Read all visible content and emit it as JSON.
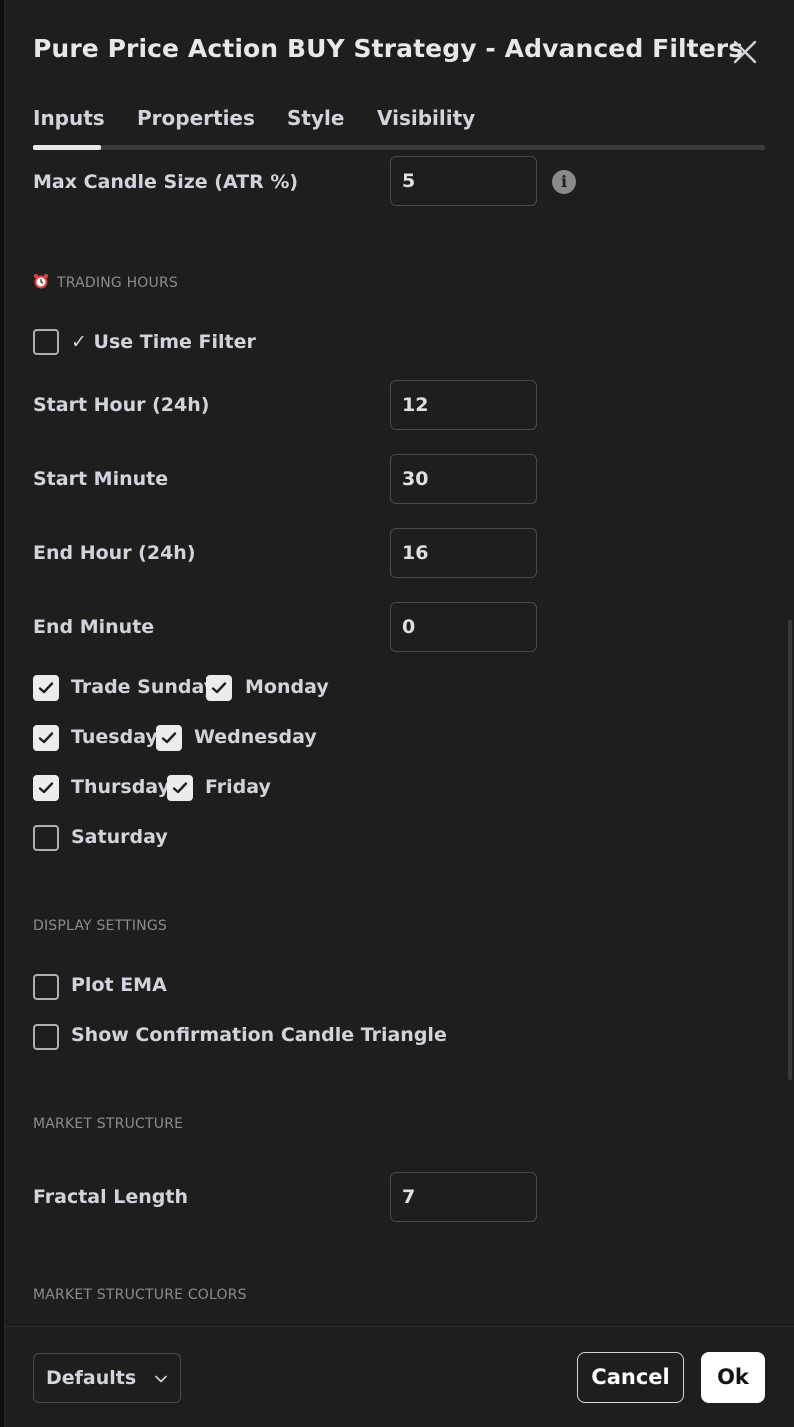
{
  "dialog": {
    "title": "Pure Price Action BUY Strategy - Advanced Filters",
    "tabs": [
      {
        "label": "Inputs",
        "active": true
      },
      {
        "label": "Properties",
        "active": false
      },
      {
        "label": "Style",
        "active": false
      },
      {
        "label": "Visibility",
        "active": false
      }
    ]
  },
  "inputs": {
    "max_candle_size": {
      "label": "Max Candle Size (ATR %)",
      "value": "5"
    },
    "trading_hours_section": "TRADING HOURS",
    "use_time_filter": {
      "label": "✓ Use Time Filter",
      "checked": false
    },
    "start_hour": {
      "label": "Start Hour (24h)",
      "value": "12"
    },
    "start_minute": {
      "label": "Start Minute",
      "value": "30"
    },
    "end_hour": {
      "label": "End Hour (24h)",
      "value": "16"
    },
    "end_minute": {
      "label": "End Minute",
      "value": "0"
    },
    "days": {
      "sunday": {
        "label": "Trade Sunday",
        "checked": true
      },
      "monday": {
        "label": "Monday",
        "checked": true
      },
      "tuesday": {
        "label": "Tuesday",
        "checked": true
      },
      "wednesday": {
        "label": "Wednesday",
        "checked": true
      },
      "thursday": {
        "label": "Thursday",
        "checked": true
      },
      "friday": {
        "label": "Friday",
        "checked": true
      },
      "saturday": {
        "label": "Saturday",
        "checked": false
      }
    },
    "display_section": "DISPLAY SETTINGS",
    "plot_ema": {
      "label": "Plot EMA",
      "checked": false
    },
    "show_triangle": {
      "label": "Show Confirmation Candle Triangle",
      "checked": false
    },
    "market_structure_section": "MARKET STRUCTURE",
    "fractal_length": {
      "label": "Fractal Length",
      "value": "7"
    },
    "market_structure_colors_section": "MARKET STRUCTURE COLORS"
  },
  "footer": {
    "defaults_label": "Defaults",
    "cancel_label": "Cancel",
    "ok_label": "Ok"
  },
  "colors": {
    "background": "#1e1e1e",
    "text": "#d1d4dc",
    "section_text": "#8c8c8c",
    "ok_button_bg": "#ffffff"
  }
}
